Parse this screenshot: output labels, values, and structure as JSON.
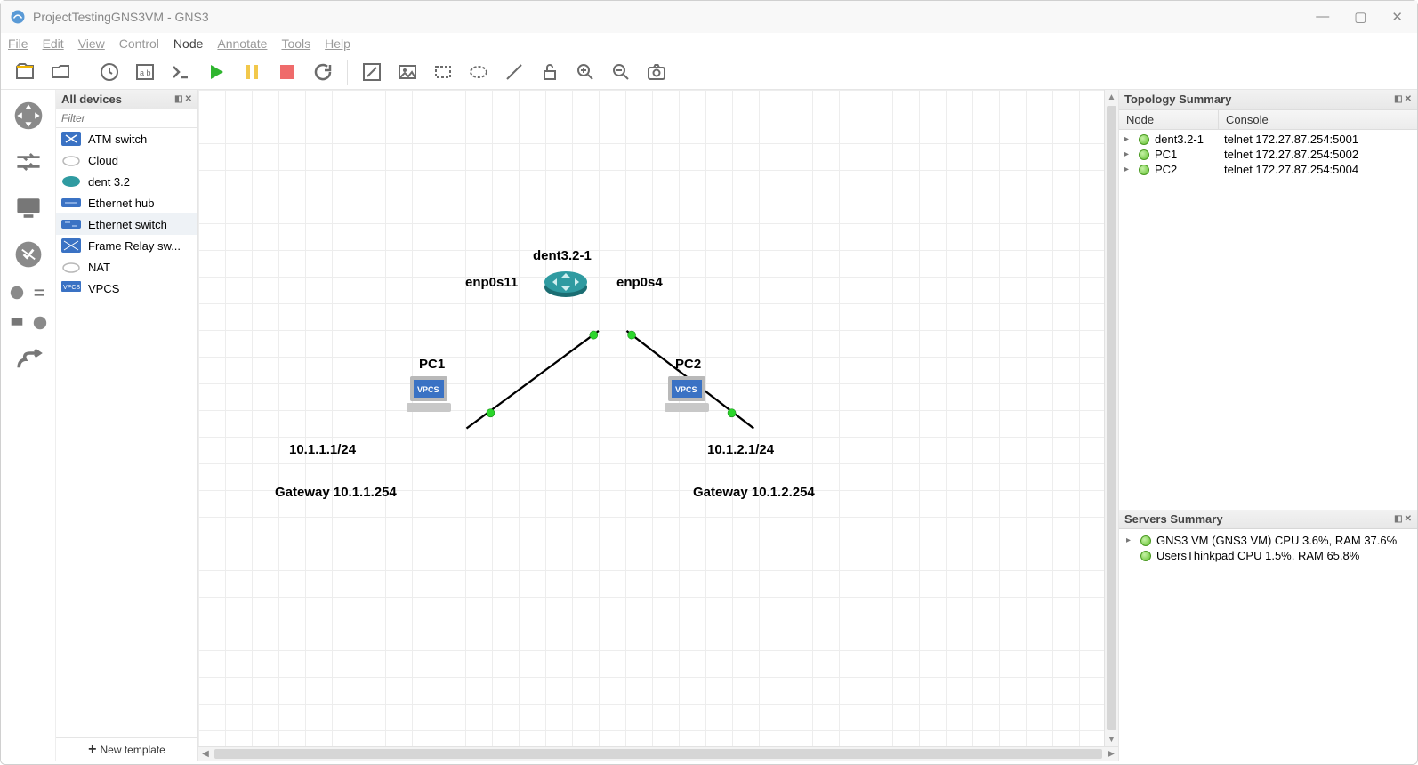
{
  "window": {
    "title": "ProjectTestingGNS3VM - GNS3"
  },
  "menu": {
    "file": "File",
    "edit": "Edit",
    "view": "View",
    "control": "Control",
    "node": "Node",
    "annotate": "Annotate",
    "tools": "Tools",
    "help": "Help"
  },
  "devices_panel": {
    "title": "All devices",
    "filter_placeholder": "Filter",
    "items": [
      {
        "label": "ATM switch",
        "icon": "atm"
      },
      {
        "label": "Cloud",
        "icon": "cloud"
      },
      {
        "label": "dent 3.2",
        "icon": "router"
      },
      {
        "label": "Ethernet hub",
        "icon": "hub"
      },
      {
        "label": "Ethernet switch",
        "icon": "switch",
        "selected": true
      },
      {
        "label": "Frame Relay sw...",
        "icon": "frelay"
      },
      {
        "label": "NAT",
        "icon": "cloud"
      },
      {
        "label": "VPCS",
        "icon": "vpcs"
      }
    ],
    "new_template": "New template"
  },
  "canvas": {
    "labels": {
      "router": "dent3.2-1",
      "if_left": "enp0s11",
      "if_right": "enp0s4",
      "pc1": "PC1",
      "pc2": "PC2",
      "ip1": "10.1.1.1/24",
      "ip2": "10.1.2.1/24",
      "gw1": "Gateway 10.1.1.254",
      "gw2": "Gateway 10.1.2.254"
    }
  },
  "topology": {
    "title": "Topology Summary",
    "cols": {
      "node": "Node",
      "console": "Console"
    },
    "rows": [
      {
        "name": "dent3.2-1",
        "console": "telnet 172.27.87.254:5001"
      },
      {
        "name": "PC1",
        "console": "telnet 172.27.87.254:5002"
      },
      {
        "name": "PC2",
        "console": "telnet 172.27.87.254:5004"
      }
    ]
  },
  "servers": {
    "title": "Servers Summary",
    "rows": [
      {
        "text": "GNS3 VM (GNS3 VM) CPU 3.6%, RAM 37.6%",
        "caret": true
      },
      {
        "text": "UsersThinkpad CPU 1.5%, RAM 65.8%",
        "caret": false
      }
    ]
  }
}
